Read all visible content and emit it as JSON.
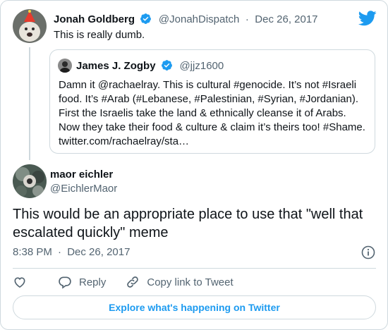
{
  "reply_tweet": {
    "author_name": "Jonah Goldberg",
    "author_handle": "@JonahDispatch",
    "separator": "·",
    "date": "Dec 26, 2017",
    "text": "This is really dumb."
  },
  "quoted_tweet": {
    "author_name": "James J. Zogby",
    "author_handle": "@jjz1600",
    "text": "Damn it @rachaelray. This is cultural #genocide. It’s not #Israeli food. It’s #Arab (#Lebanese, #Palestinian, #Syrian, #Jordanian). First the Israelis take the land & ethnically cleanse it of Arabs. Now they take their food & culture & claim it’s theirs too! #Shame. twitter.com/rachaelray/sta…"
  },
  "main_tweet": {
    "author_name": "maor eichler",
    "author_handle": "@EichlerMaor",
    "text": "This would be an appropriate place to use that \"well that escalated quickly\" meme",
    "time": "8:38 PM",
    "separator": "·",
    "date": "Dec 26, 2017"
  },
  "actions": {
    "reply_label": "Reply",
    "copy_link_label": "Copy link to Tweet"
  },
  "explore_label": "Explore what's happening on Twitter",
  "colors": {
    "accent": "#1d9bf0",
    "text": "#0f1419",
    "secondary": "#536471",
    "border": "#cfd9de"
  },
  "icons": [
    "twitter-bird-icon",
    "verified-badge-icon",
    "info-icon",
    "heart-icon",
    "reply-icon",
    "link-icon"
  ]
}
